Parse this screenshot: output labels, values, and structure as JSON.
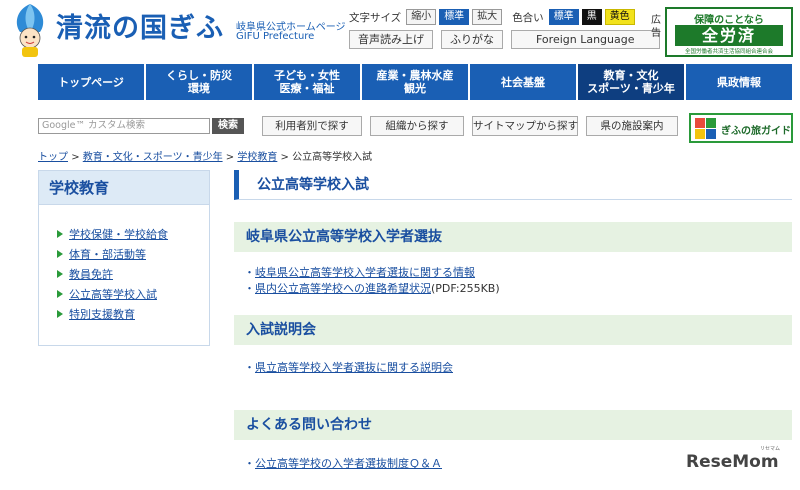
{
  "header": {
    "logo_text": "清流の国ぎふ",
    "logo_sub_jp": "岐阜県公式ホームページ",
    "logo_sub_en": "GIFU Prefecture"
  },
  "utility": {
    "font_size_label": "文字サイズ",
    "font_small": "縮小",
    "font_standard": "標準",
    "font_large": "拡大",
    "color_label": "色合い",
    "color_standard": "標準",
    "color_black": "黒",
    "color_yellow": "黄色",
    "read_aloud": "音声読み上げ",
    "furigana": "ふりがな",
    "foreign_language": "Foreign Language"
  },
  "ad": {
    "label": "広告",
    "line1": "保障のことなら",
    "line2": "全労済",
    "line3": "全国労働者共済生活協同組合連合会"
  },
  "nav": [
    {
      "label": "トップページ"
    },
    {
      "label": "くらし・防災\n環境"
    },
    {
      "label": "子ども・女性\n医療・福祉"
    },
    {
      "label": "産業・農林水産\n観光"
    },
    {
      "label": "社会基盤"
    },
    {
      "label": "教育・文化\nスポーツ・青少年"
    },
    {
      "label": "県政情報"
    }
  ],
  "search": {
    "placeholder": "Google™ カスタム検索",
    "button": "検索"
  },
  "tools": {
    "by_user": "利用者別で探す",
    "by_org": "組織から探す",
    "sitemap": "サイトマップから探す",
    "facilities": "県の施設案内",
    "tabi_guide": "ぎふの旅ガイド"
  },
  "breadcrumb": {
    "top": "トップ",
    "sep": ">",
    "category": "教育・文化・スポーツ・青少年",
    "section": "学校教育",
    "current": "公立高等学校入試"
  },
  "sidebar": {
    "title": "学校教育",
    "items": [
      {
        "label": "学校保健・学校給食"
      },
      {
        "label": "体育・部活動等"
      },
      {
        "label": "教員免許"
      },
      {
        "label": "公立高等学校入試"
      },
      {
        "label": "特別支援教育"
      }
    ]
  },
  "main": {
    "title": "公立高等学校入試",
    "sections": [
      {
        "heading": "岐阜県公立高等学校入学者選抜",
        "links": [
          {
            "bullet": "・",
            "text": "岐阜県公立高等学校入学者選抜に関する情報",
            "suffix": ""
          },
          {
            "bullet": "・",
            "text": "県内公立高等学校への進路希望状況",
            "suffix": "(PDF:255KB)"
          }
        ]
      },
      {
        "heading": "入試説明会",
        "links": [
          {
            "bullet": "・",
            "text": "県立高等学校入学者選抜に関する説明会",
            "suffix": ""
          }
        ]
      },
      {
        "heading": "よくある問い合わせ",
        "links": [
          {
            "bullet": "・",
            "text": "公立高等学校の入学者選抜制度Ｑ＆Ａ",
            "suffix": ""
          }
        ]
      }
    ]
  },
  "watermark": {
    "text": "ReseMom",
    "sub": "リセマム"
  },
  "colors": {
    "brand_blue": "#1a5fb4",
    "nav_active": "#0e3e80",
    "section_bg": "#e6f2e2",
    "accent_green": "#2a9a3a"
  }
}
